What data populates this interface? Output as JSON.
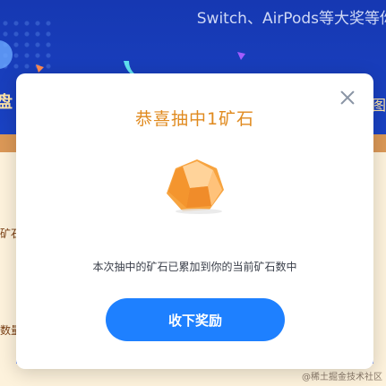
{
  "background": {
    "banner_text": "Switch、AirPods等大奖等你",
    "left_label": "盘",
    "right_label": "图",
    "left_text_1": "矿石",
    "left_text_2": "数量",
    "watermark": "@稀土掘金技术社区"
  },
  "modal": {
    "title": "恭喜抽中1矿石",
    "message": "本次抽中的矿石已累加到你的当前矿石数中",
    "collect_button_label": "收下奖励",
    "close_icon": "close-icon",
    "reward_icon": "ore-icon"
  },
  "colors": {
    "title": "#e08a1e",
    "button": "#1e80ff",
    "background": "#1a3fb8"
  }
}
